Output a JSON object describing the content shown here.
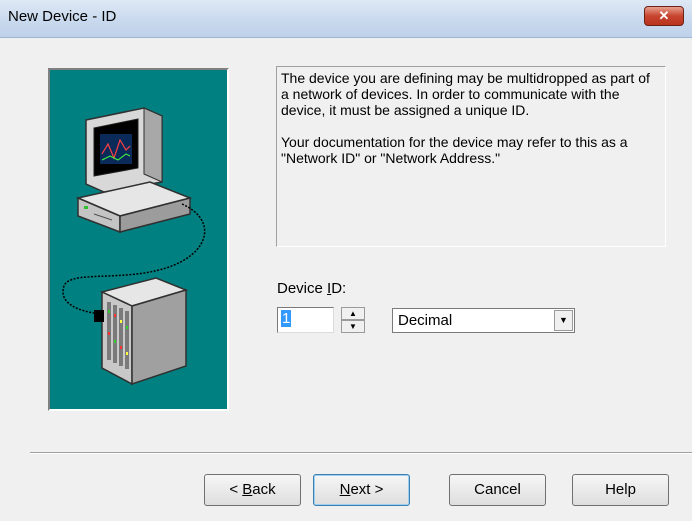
{
  "window": {
    "title": "New Device - ID",
    "close_glyph": "✕"
  },
  "info": {
    "paragraph1": "The device you are defining may be multidropped as part of a network of devices.  In order to communicate with the device, it must be assigned a unique ID.",
    "paragraph2": "Your documentation for the device may refer to this as a \"Network ID\" or \"Network Address.\""
  },
  "device_id": {
    "label_prefix": "Device ",
    "label_accel": "I",
    "label_suffix": "D:",
    "value": "1",
    "up_glyph": "▲",
    "down_glyph": "▼"
  },
  "format": {
    "selected": "Decimal",
    "arrow_glyph": "▼"
  },
  "buttons": {
    "back_prefix": "< ",
    "back_accel": "B",
    "back_suffix": "ack",
    "next_accel": "N",
    "next_suffix": "ext >",
    "cancel": "Cancel",
    "help": "Help"
  },
  "illustration": {
    "icons": [
      "computer-monitor-icon",
      "network-cable-icon",
      "device-rack-icon"
    ],
    "background_color": "#008080"
  }
}
